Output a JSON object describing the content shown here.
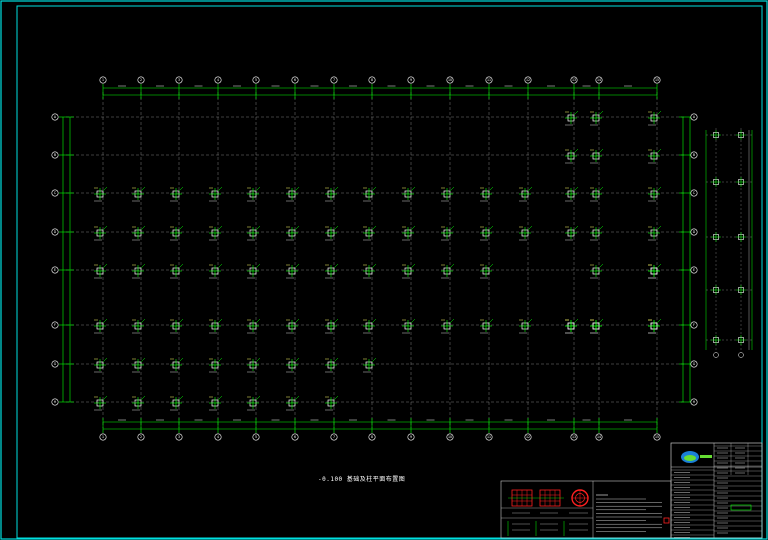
{
  "drawing": {
    "title": "-0.100 基础及柱平面布置图",
    "background": "#000000",
    "frame_color": "#00e0e0",
    "grid_color": "#8a8a8a",
    "dim_color": "#00ff00",
    "column_color": "#ffffff",
    "label_color": "#ffff66",
    "accent_red": "#ff2020",
    "x_axes": [
      "1",
      "2",
      "3",
      "4",
      "5",
      "6",
      "7",
      "8",
      "9",
      "10",
      "11",
      "12",
      "13",
      "14",
      "15"
    ],
    "y_axes": [
      "A",
      "B",
      "C",
      "D",
      "E",
      "F",
      "G",
      "H"
    ]
  },
  "title_block": {
    "logo_text": "设计院",
    "rows": [
      "工程名称",
      "子项名称",
      "图纸名称",
      "设计",
      "校对",
      "审核",
      "审定",
      "项目负责",
      "专业负责",
      "日期",
      "比例",
      "图号"
    ]
  },
  "legend": {
    "details": [
      "柱脚详图一",
      "柱脚详图二",
      "柱脚详图三"
    ],
    "notes": [
      "说明："
    ]
  }
}
